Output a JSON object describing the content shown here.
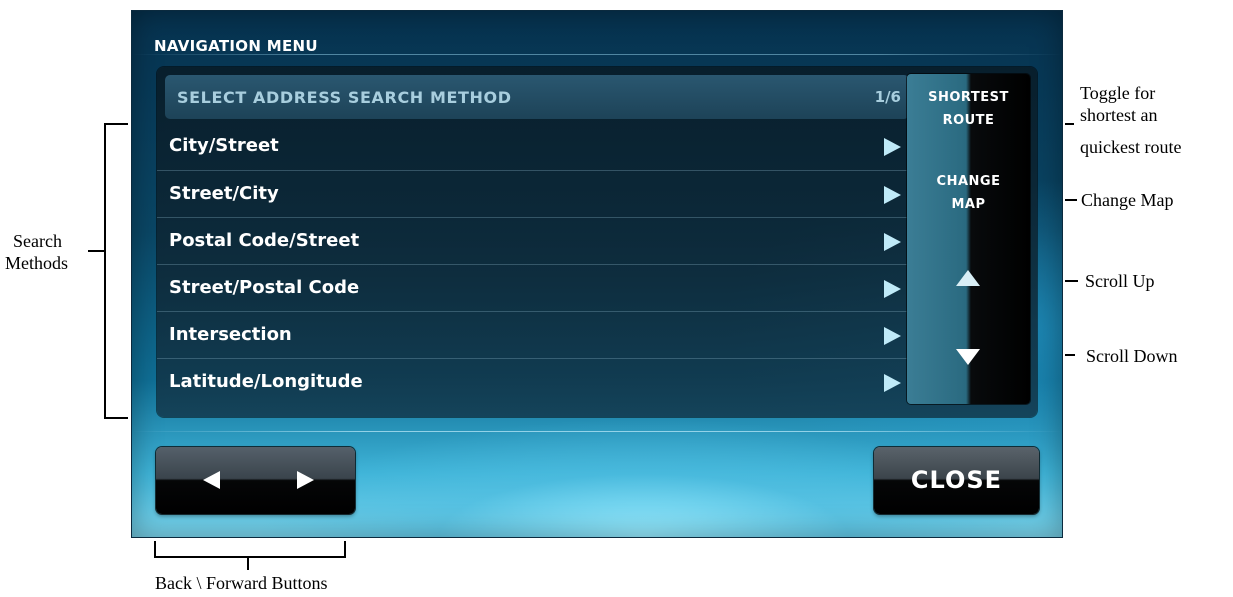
{
  "screen": {
    "title": "NAVIGATION MENU",
    "list_header": {
      "label": "SELECT ADDRESS SEARCH METHOD",
      "page": "1/6"
    },
    "methods": [
      {
        "label": "City/Street"
      },
      {
        "label": "Street/City"
      },
      {
        "label": "Postal Code/Street"
      },
      {
        "label": "Street/Postal Code"
      },
      {
        "label": "Intersection"
      },
      {
        "label": "Latitude/Longitude"
      }
    ],
    "side": {
      "route_line1": "SHORTEST",
      "route_line2": "ROUTE",
      "map_line1": "CHANGE",
      "map_line2": "MAP"
    },
    "close_label": "CLOSE"
  },
  "annotations": {
    "search_methods": [
      "Search",
      "Methods"
    ],
    "toggle_route": [
      "Toggle for",
      "shortest an",
      "quickest route"
    ],
    "change_map": "Change Map",
    "scroll_up": "Scroll Up",
    "scroll_down": "Scroll Down",
    "back_forward": "Back \\ Forward Buttons"
  },
  "icons": {
    "row_arrow": "play-triangle",
    "scroll_up": "triangle-up",
    "scroll_down": "triangle-down",
    "back": "triangle-left",
    "forward": "triangle-right"
  },
  "colors": {
    "screen_dark": "#06324f",
    "screen_glow": "#7bd6ee",
    "header_text": "#a8cede",
    "row_arrow": "#bfeaf8"
  }
}
